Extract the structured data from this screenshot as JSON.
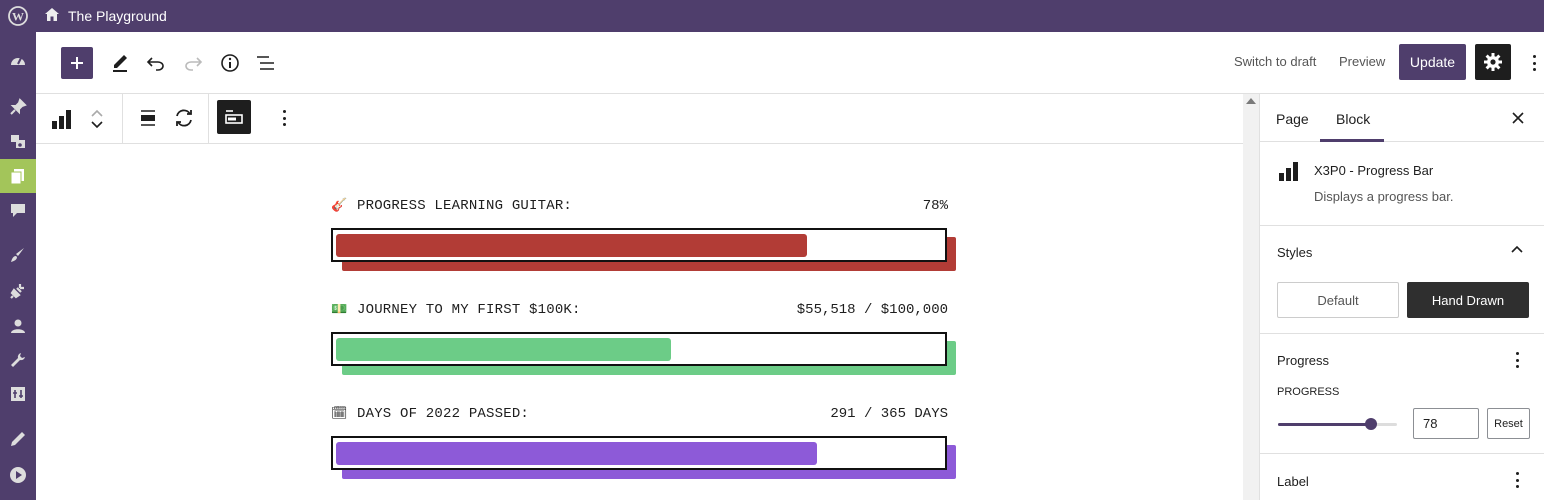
{
  "admin_bar": {
    "site_name": "The Playground"
  },
  "header": {
    "switch_to_draft": "Switch to draft",
    "preview": "Preview",
    "update": "Update"
  },
  "colors": {
    "admin": "#4f3e6c",
    "bar_red": "#b23c36",
    "bar_green": "#6ccc87",
    "bar_purple": "#8d5ad8"
  },
  "progress_bars": [
    {
      "icon": "guitar-icon",
      "glyph": "🎸",
      "label": "PROGRESS LEARNING GUITAR:",
      "value": "78%",
      "fraction": 0.78
    },
    {
      "icon": "money-icon",
      "glyph": "💵",
      "label": "JOURNEY TO MY FIRST $100K:",
      "value": "$55,518 / $100,000",
      "fraction": 0.555
    },
    {
      "icon": "calendar-icon",
      "glyph": "🗓",
      "label": "DAYS OF 2022 PASSED:",
      "value": "291 / 365 DAYS",
      "fraction": 0.797
    }
  ],
  "sidebar": {
    "tabs": [
      "Page",
      "Block"
    ],
    "block_title": "X3P0 - Progress Bar",
    "block_description": "Displays a progress bar.",
    "styles_heading": "Styles",
    "style_default": "Default",
    "style_hand_drawn": "Hand Drawn",
    "progress_heading": "Progress",
    "progress_label": "PROGRESS",
    "progress_value": "78",
    "progress_fraction": 0.78,
    "reset": "Reset",
    "label_heading": "Label"
  }
}
